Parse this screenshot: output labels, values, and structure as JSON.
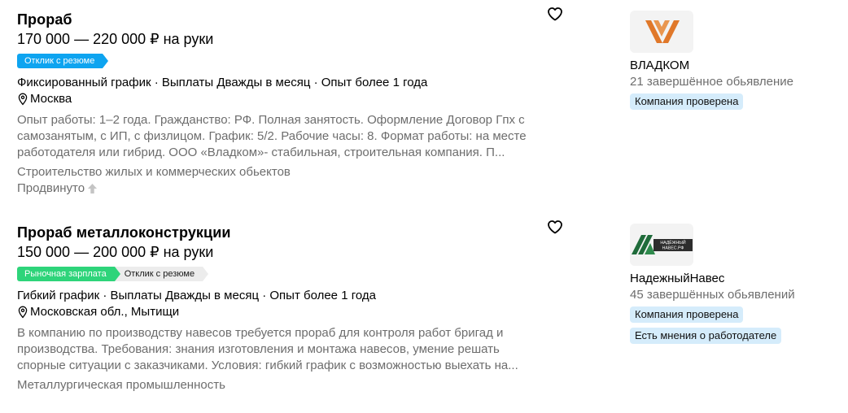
{
  "vacancies": [
    {
      "title": "Прораб",
      "salary": "170 000 — 220 000 ₽ на руки",
      "badges": [
        {
          "label": "Отклик с резюме",
          "style": "blue"
        }
      ],
      "conditions": "Фиксированный график · Выплаты Дважды в месяц · Опыт более 1 года",
      "location": "Москва",
      "description": "Опыт работы: 1–2 года. Гражданство: РФ. Полная занятость. Оформление Договор Гпх с самозанятым, с ИП, с физлицом. График: 5/2. Рабочие часы: 8. Формат работы: на месте работодателя или гибрид. ООО «Владком»- стабильная, строительная компания. П...",
      "industry": "Строительство жилых и коммерческих обьектов",
      "promoted": "Продвинуто",
      "company": {
        "name": "ВЛАДКОМ",
        "ads": "21 завершённое обьявление",
        "tags": [
          "Компания проверена"
        ],
        "logo": "vladkom-logo",
        "logo_color": "#e0782a"
      }
    },
    {
      "title": "Прораб металлоконструкции",
      "salary": "150 000 — 200 000 ₽ на руки",
      "badges": [
        {
          "label": "Рыночная зарплата",
          "style": "green"
        },
        {
          "label": "Отклик с резюме",
          "style": "gray"
        }
      ],
      "conditions": "Гибкий график · Выплаты Дважды в месяц · Опыт более 1 года",
      "location": "Московская обл., Мытищи",
      "description": "В компанию по производству навесов требуется прораб для контроля работ бригад и производства. Требования: знания изготовления и монтажа навесов, умение решать спорные ситуации с заказчиками. Условия: гибкий график с возможностью выехать на...",
      "industry": "Металлургическая промышленность",
      "company": {
        "name": "НадежныйНавес",
        "ads": "45 завершённых обьявлений",
        "tags": [
          "Компания проверена",
          "Есть мнения о работодателе"
        ],
        "logo": "nadezhny-naves-logo",
        "logo_text": "НАДЁЖНЫЙ НАВЕС.РФ",
        "logo_color": "#1f6b3a"
      }
    }
  ],
  "colors": {
    "accent_blue": "#0ea4f0",
    "accent_green": "#2ed47a",
    "muted_text": "#6d6d6d",
    "tag_bg": "#d5ecfb"
  }
}
